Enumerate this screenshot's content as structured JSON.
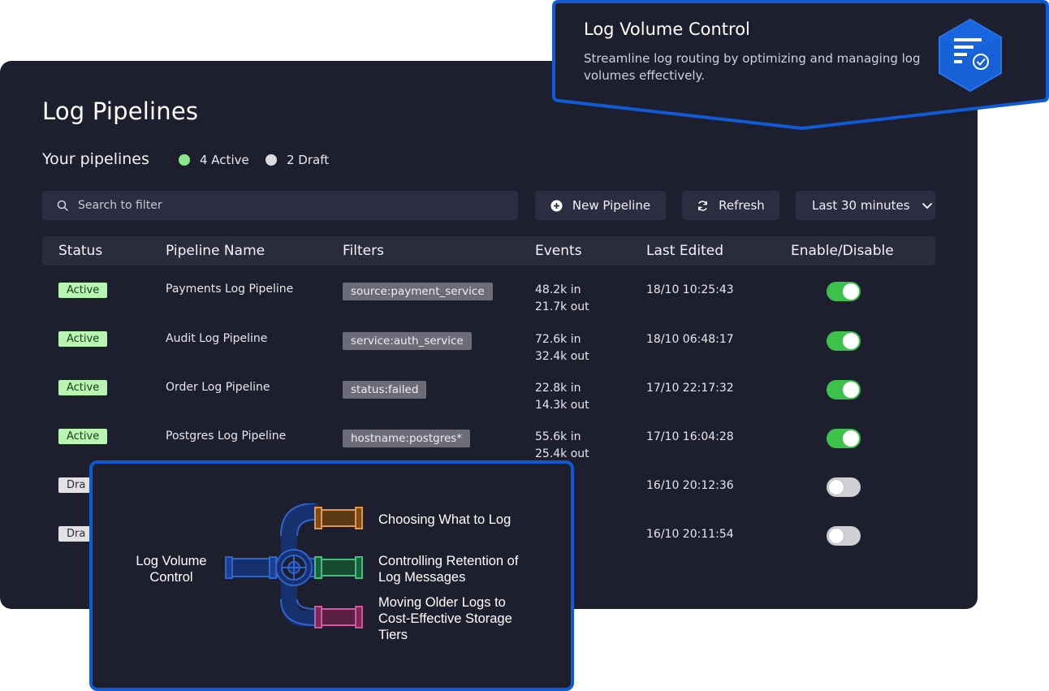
{
  "panel": {
    "title": "Log Pipelines",
    "subtitle": "Your pipelines",
    "active_count": "4 Active",
    "draft_count": "2 Draft",
    "search_placeholder": "Search to filter",
    "new_pipeline_label": "New Pipeline",
    "refresh_label": "Refresh",
    "time_range_label": "Last 30 minutes"
  },
  "table": {
    "headers": [
      "Status",
      "Pipeline Name",
      "Filters",
      "Events",
      "Last Edited",
      "Enable/Disable"
    ],
    "rows": [
      {
        "status": "Active",
        "name": "Payments Log Pipeline",
        "filter": "source:payment_service",
        "events_in": "48.2k in",
        "events_out": "21.7k out",
        "edited": "18/10  10:25:43",
        "enabled": true
      },
      {
        "status": "Active",
        "name": "Audit Log Pipeline",
        "filter": "service:auth_service",
        "events_in": "72.6k in",
        "events_out": "32.4k out",
        "edited": "18/10  06:48:17",
        "enabled": true
      },
      {
        "status": "Active",
        "name": "Order Log Pipeline",
        "filter": "status:failed",
        "events_in": "22.8k in",
        "events_out": "14.3k out",
        "edited": "17/10  22:17:32",
        "enabled": true
      },
      {
        "status": "Active",
        "name": "Postgres Log Pipeline",
        "filter": "hostname:postgres*",
        "events_in": "55.6k in",
        "events_out": "25.4k out",
        "edited": "17/10  16:04:28",
        "enabled": true
      },
      {
        "status": "Dra",
        "edited": "16/10  20:12:36",
        "enabled": false
      },
      {
        "status": "Dra",
        "edited": "16/10  20:11:54",
        "enabled": false
      }
    ]
  },
  "callout": {
    "title": "Log Volume Control",
    "text": "Streamline log routing by optimizing and managing log volumes effectively.",
    "icon": "log-filter-check-icon"
  },
  "diagram": {
    "center_label_line1": "Log Volume",
    "center_label_line2": "Control",
    "branches": [
      {
        "line1": "Choosing What to Log",
        "color": "#e8963a"
      },
      {
        "line1": "Controlling Retention of",
        "line2": "Log Messages",
        "color": "#3fbf78"
      },
      {
        "line1": "Moving Older Logs to",
        "line2": "Cost-Effective Storage",
        "line3": "Tiers",
        "color": "#d6569e"
      }
    ],
    "pipe_color": "#1f4fb0"
  },
  "colors": {
    "panel_bg": "#1e1f2e",
    "accent_blue": "#0f5ad6",
    "active_badge": "#b9f5b2",
    "toggle_on": "#3cc24a"
  }
}
